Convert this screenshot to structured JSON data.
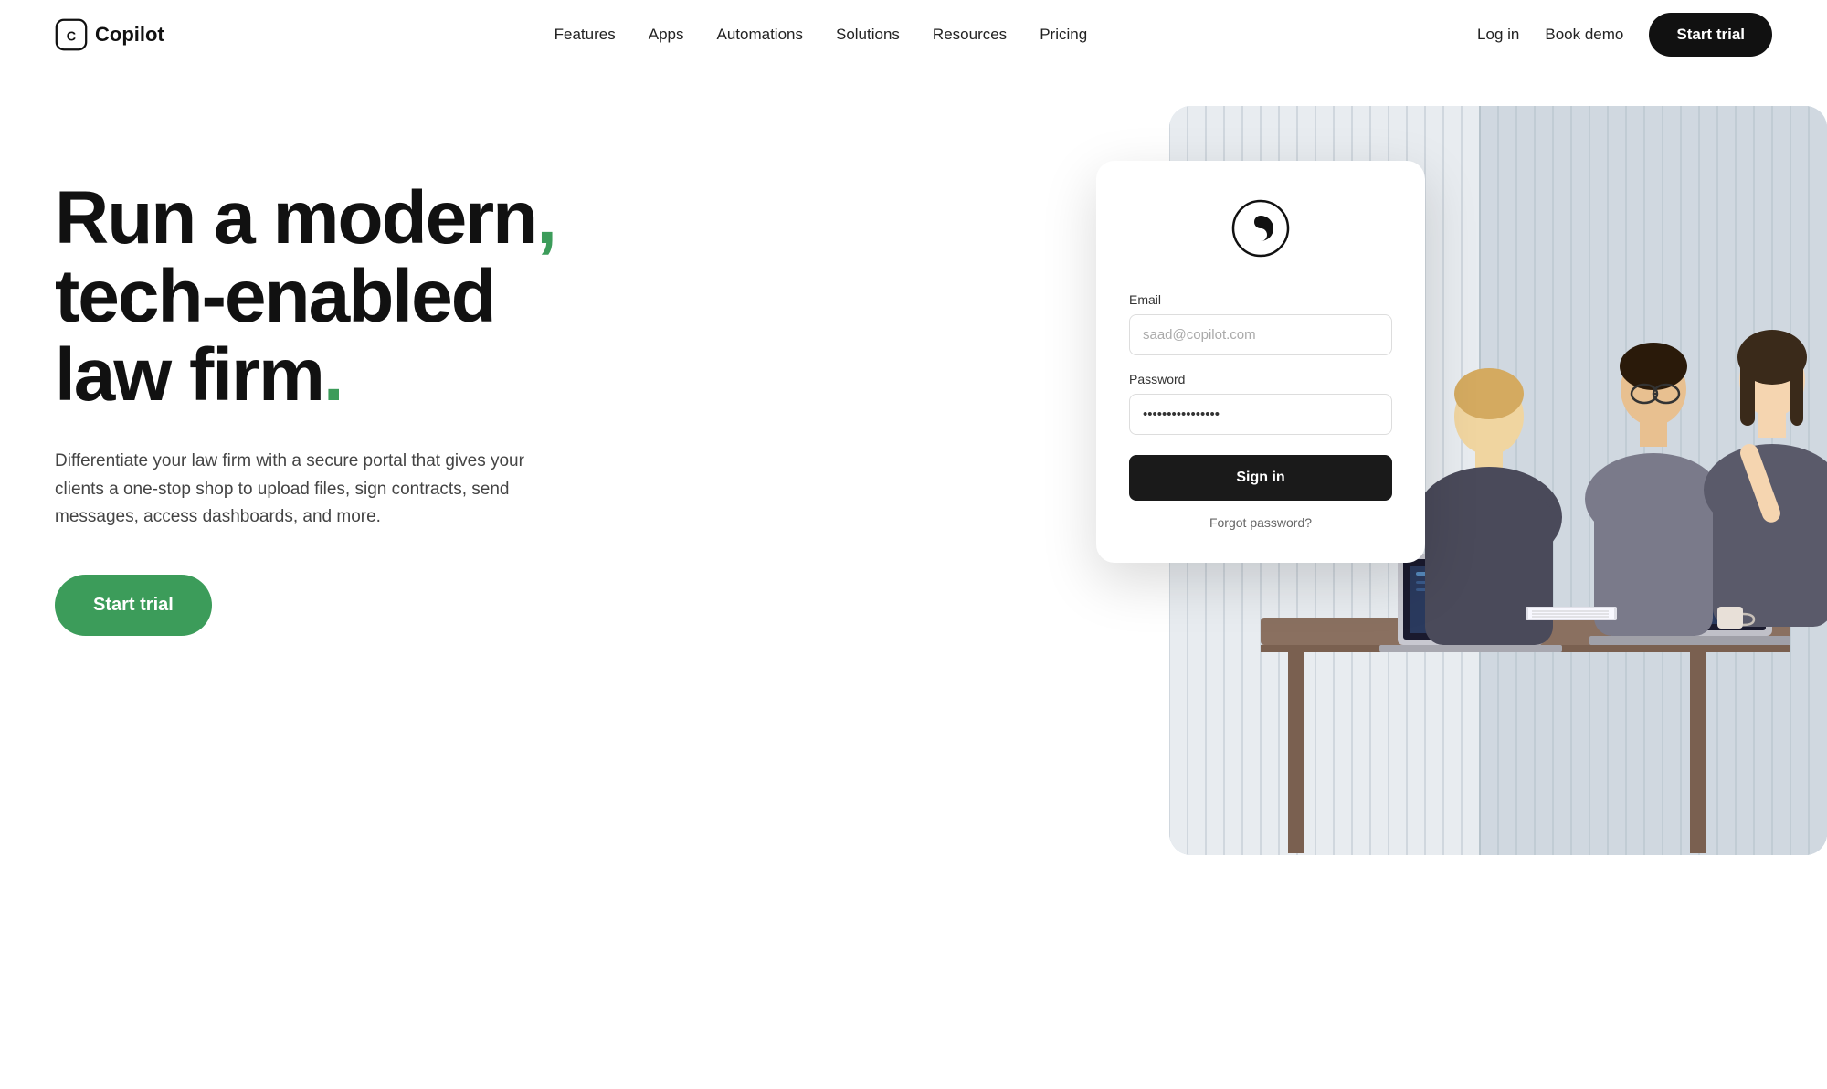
{
  "brand": {
    "name": "Copilot",
    "logo_symbol": "(C)"
  },
  "nav": {
    "links": [
      {
        "label": "Features",
        "href": "#"
      },
      {
        "label": "Apps",
        "href": "#"
      },
      {
        "label": "Automations",
        "href": "#"
      },
      {
        "label": "Solutions",
        "href": "#"
      },
      {
        "label": "Resources",
        "href": "#"
      },
      {
        "label": "Pricing",
        "href": "#"
      }
    ],
    "login_label": "Log in",
    "book_demo_label": "Book demo",
    "start_trial_label": "Start trial"
  },
  "hero": {
    "heading_line1": "Run a modern,",
    "heading_line2": "tech-enabled",
    "heading_line3": "law firm.",
    "subtext": "Differentiate your law firm with a secure portal that gives your clients a one-stop shop to upload files, sign contracts, send messages, access dashboards, and more.",
    "cta_label": "Start trial"
  },
  "login_card": {
    "email_label": "Email",
    "email_placeholder": "saad@copilot.com",
    "password_label": "Password",
    "password_value": "••••••••••••••••",
    "sign_in_label": "Sign in",
    "forgot_password_label": "Forgot password?"
  },
  "colors": {
    "green_accent": "#3c9c5a",
    "dark": "#111111",
    "white": "#ffffff"
  }
}
